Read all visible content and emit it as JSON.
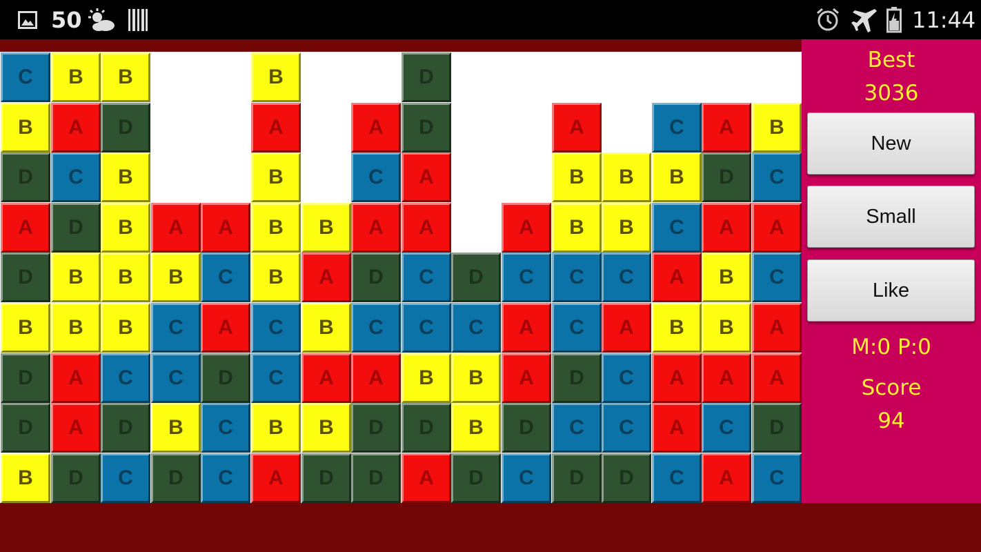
{
  "status_bar": {
    "temperature": "50",
    "time": "11:44",
    "icons": [
      "image-notification-icon",
      "partly-cloudy-icon",
      "barcode-icon",
      "alarm-icon",
      "airplane-mode-icon",
      "battery-icon"
    ]
  },
  "panel": {
    "best_label": "Best",
    "best_value": "3036",
    "buttons": {
      "new": "New",
      "small": "Small",
      "like": "Like"
    },
    "moves": "M:0 P:0",
    "score_label": "Score",
    "score_value": "94"
  },
  "tile_colors": {
    "A": {
      "bg": "#f40d0d",
      "fg": "#a50505"
    },
    "B": {
      "bg": "#fefe10",
      "fg": "#5d5200"
    },
    "C": {
      "bg": "#0b73a8",
      "fg": "#0a3f5c"
    },
    "D": {
      "bg": "#2f5230",
      "fg": "#1c321c"
    }
  },
  "board": {
    "columns": 16,
    "rows": 9,
    "grid": [
      [
        "C",
        "B",
        "B",
        "",
        "",
        "B",
        "",
        "",
        "D",
        "",
        "",
        "",
        "",
        "",
        "",
        ""
      ],
      [
        "B",
        "A",
        "D",
        "",
        "",
        "A",
        "",
        "A",
        "D",
        "",
        "",
        "A",
        "",
        "C",
        "A",
        "B"
      ],
      [
        "D",
        "C",
        "B",
        "",
        "",
        "B",
        "",
        "C",
        "A",
        "",
        "",
        "B",
        "B",
        "B",
        "D",
        "C"
      ],
      [
        "A",
        "D",
        "B",
        "A",
        "A",
        "B",
        "B",
        "A",
        "A",
        "",
        "A",
        "B",
        "B",
        "C",
        "A",
        "A"
      ],
      [
        "D",
        "B",
        "B",
        "B",
        "C",
        "B",
        "A",
        "D",
        "C",
        "D",
        "C",
        "C",
        "C",
        "A",
        "B",
        "C"
      ],
      [
        "B",
        "B",
        "B",
        "C",
        "A",
        "C",
        "B",
        "C",
        "C",
        "C",
        "A",
        "C",
        "A",
        "B",
        "B",
        "A"
      ],
      [
        "D",
        "A",
        "C",
        "C",
        "D",
        "C",
        "A",
        "A",
        "B",
        "B",
        "A",
        "D",
        "C",
        "A",
        "A",
        "A"
      ],
      [
        "D",
        "A",
        "D",
        "B",
        "C",
        "B",
        "B",
        "D",
        "D",
        "B",
        "D",
        "C",
        "C",
        "A",
        "C",
        "D"
      ],
      [
        "B",
        "D",
        "C",
        "D",
        "C",
        "A",
        "D",
        "D",
        "A",
        "D",
        "C",
        "D",
        "D",
        "C",
        "A",
        "C"
      ]
    ]
  }
}
